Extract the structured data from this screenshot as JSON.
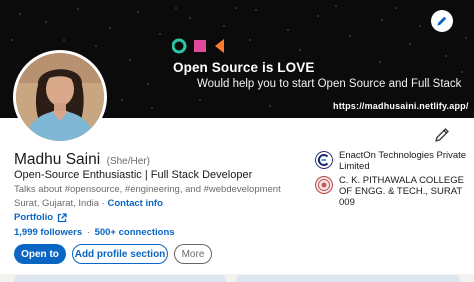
{
  "banner": {
    "title": "Open Source is LOVE",
    "tagline": "Would help you to start Open Source and Full Stack",
    "url": "https://madhusaini.netlify.app/"
  },
  "profile": {
    "name": "Madhu Saini",
    "pronouns": "(She/Her)",
    "headline": "Open-Source Enthusiastic | Full Stack Developer",
    "talks_about": "Talks about #opensource, #engineering, and #webdevelopment",
    "location": "Surat, Gujarat, India",
    "location_separator": " · ",
    "contact_info_label": "Contact info",
    "portfolio_label": "Portfolio",
    "followers": "1,999 followers",
    "stats_separator": "·",
    "connections": "500+ connections"
  },
  "actions": {
    "open_to_label": "Open to",
    "add_section_label": "Add profile section",
    "more_label": "More"
  },
  "organizations": [
    {
      "name": "EnactOn Technologies Private Limited",
      "icon": "enacton-logo"
    },
    {
      "name": "C. K. PITHAWALA COLLEGE OF ENGG. & TECH., SURAT 009",
      "icon": "college-seal"
    }
  ],
  "colors": {
    "linkedin_blue": "#0a66c2",
    "banner_bg": "#0b0b0b",
    "card_bg": "#ffffff",
    "page_bg": "#f3f2ef"
  }
}
